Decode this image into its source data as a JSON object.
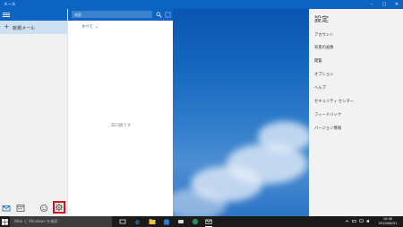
{
  "window": {
    "title": "メール",
    "minimize": "–",
    "maximize": "□",
    "close": "✕",
    "accent": "#0c63c2"
  },
  "nav": {
    "new_mail_label": "新規メール",
    "new_mail_icon": "+",
    "bottom_icons": [
      "mail-icon",
      "calendar-icon",
      "people-icon",
      "settings-icon"
    ]
  },
  "list": {
    "search_placeholder": "検索",
    "filter_label": "すべて",
    "filter_chevron": "⌄",
    "empty_text": "未同期です"
  },
  "settings": {
    "title": "設定",
    "items": [
      "アカウント",
      "背景の画像",
      "閲覧",
      "オプション",
      "ヘルプ",
      "セキュリティ センター",
      "フィードバック",
      "バージョン情報"
    ]
  },
  "taskbar": {
    "search_placeholder": "Web と Windows を検索",
    "time": "10:45",
    "date": "2015/08/31"
  }
}
